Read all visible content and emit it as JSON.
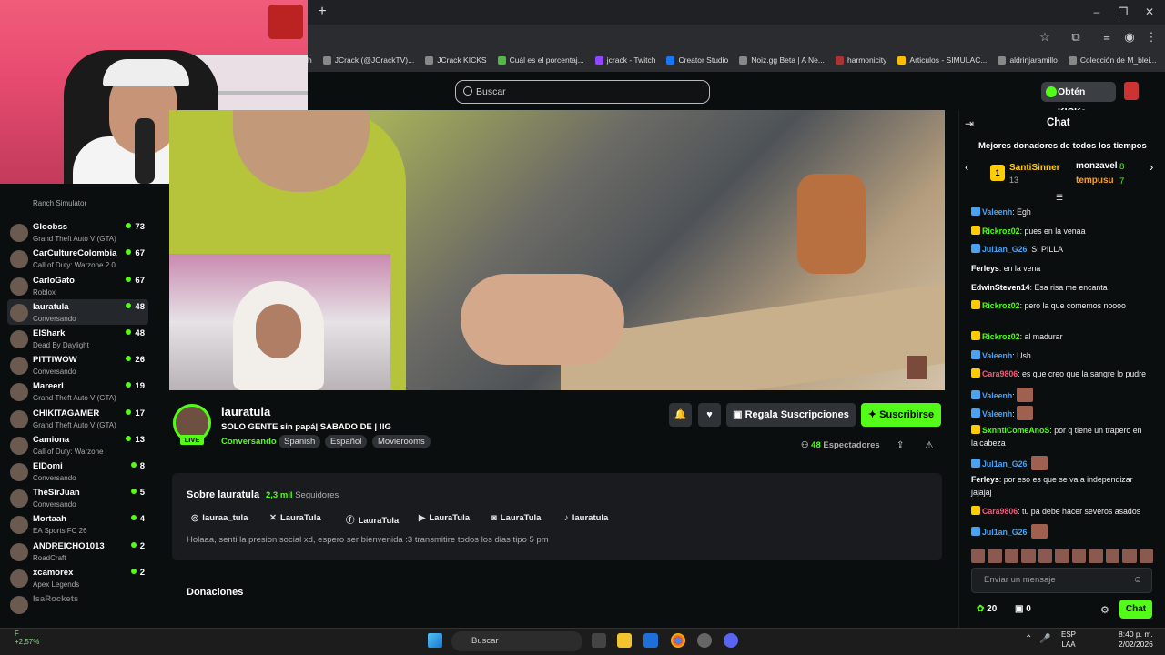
{
  "browser": {
    "bookmarks": [
      "h",
      "JCrack (@JCrackTV)...",
      "JCrack KICKS",
      "Cuál es el porcentaj...",
      "jcrack - Twitch",
      "Creator Studio",
      "Noiz.gg Beta | A Ne...",
      "harmonicity",
      "Articulos - SIMULAC...",
      "aldrinjaramillo",
      "Colección de M_blei..."
    ]
  },
  "header": {
    "search_placeholder": "Buscar",
    "kicks_button": "Obtén KICKs"
  },
  "sidebar": {
    "items": [
      {
        "name": "",
        "game": "Ranch Simulator",
        "viewers": ""
      },
      {
        "name": "Gloobss",
        "game": "Grand Theft Auto V (GTA)",
        "viewers": "73"
      },
      {
        "name": "CarCultureColombia",
        "game": "Call of Duty: Warzone 2.0",
        "viewers": "67"
      },
      {
        "name": "CarloGato",
        "game": "Roblox",
        "viewers": "67"
      },
      {
        "name": "lauratula",
        "game": "Conversando",
        "viewers": "48"
      },
      {
        "name": "ElShark",
        "game": "Dead By Daylight",
        "viewers": "48"
      },
      {
        "name": "PITTIWOW",
        "game": "Conversando",
        "viewers": "26"
      },
      {
        "name": "Mareerl",
        "game": "Grand Theft Auto V (GTA)",
        "viewers": "19"
      },
      {
        "name": "CHIKITAGAMER",
        "game": "Grand Theft Auto V (GTA)",
        "viewers": "17"
      },
      {
        "name": "Camiona",
        "game": "Call of Duty: Warzone",
        "viewers": "13"
      },
      {
        "name": "ElDomi",
        "game": "Conversando",
        "viewers": "8"
      },
      {
        "name": "TheSirJuan",
        "game": "Conversando",
        "viewers": "5"
      },
      {
        "name": "Mortaah",
        "game": "EA Sports FC 26",
        "viewers": "4"
      },
      {
        "name": "ANDREICHO1013",
        "game": "RoadCraft",
        "viewers": "2"
      },
      {
        "name": "xcamorex",
        "game": "Apex Legends",
        "viewers": "2"
      },
      {
        "name": "IsaRockets",
        "game": "",
        "viewers": ""
      }
    ]
  },
  "channel": {
    "name": "lauratula",
    "live": "LIVE",
    "title": "SOLO GENTE sin papá| SABADO DE | !IG",
    "category": "Conversando",
    "tags": [
      "Spanish",
      "Español",
      "Movierooms"
    ],
    "gift_button": "Regala Suscripciones",
    "subscribe_button": "Suscribirse",
    "viewers_count": "48",
    "viewers_label": "Espectadores"
  },
  "about": {
    "title": "Sobre lauratula",
    "followers_count": "2,3 mil",
    "followers_label": "Seguidores",
    "socials": [
      {
        "icon": "instagram-icon",
        "label": "lauraa_tula"
      },
      {
        "icon": "x-icon",
        "label": "LauraTula"
      },
      {
        "icon": "facebook-icon",
        "label": "LauraTula"
      },
      {
        "icon": "youtube-icon",
        "label": "LauraTula"
      },
      {
        "icon": "discord-icon",
        "label": "LauraTula"
      },
      {
        "icon": "tiktok-icon",
        "label": "lauratula"
      }
    ],
    "description": "Holaaa, senti la presion social xd, espero ser bienvenida :3 transmitire todos los dias tipo 5 pm",
    "donations_title": "Donaciones"
  },
  "chat": {
    "title": "Chat",
    "donors_title": "Mejores donadores de todos los tiempos",
    "donors": [
      {
        "rank": "1",
        "name": "SantiSinner",
        "amount": "13"
      },
      {
        "name": "monzavel",
        "amount": "8"
      },
      {
        "name": "tempusu",
        "amount": "7"
      }
    ],
    "messages": [
      {
        "user": "Valeenh",
        "color": "#4aa3f0",
        "text": "Egh"
      },
      {
        "user": "Rickroz02",
        "color": "#53fc18",
        "text": "pues en la venaa"
      },
      {
        "user": "Jul1an_G26",
        "color": "#4aa3f0",
        "text": "SI PILLA"
      },
      {
        "user": "Ferleys",
        "color": "#ffffff",
        "text": "en la vena"
      },
      {
        "user": "EdwinSteven14",
        "color": "#ffffff",
        "text": "Esa risa me encanta"
      },
      {
        "user": "Rickroz02",
        "color": "#53fc18",
        "text": "pero la que comemos noooo"
      },
      {
        "user": "Rickroz02",
        "color": "#53fc18",
        "text": "al madurar"
      },
      {
        "user": "Valeenh",
        "color": "#4aa3f0",
        "text": "Ush"
      },
      {
        "user": "Cara9806",
        "color": "#f05c7a",
        "text": "es que creo que la sangre lo pudre"
      },
      {
        "user": "Valeenh",
        "color": "#4aa3f0",
        "text": ""
      },
      {
        "user": "Valeenh",
        "color": "#4aa3f0",
        "text": ""
      },
      {
        "user": "SxnntiComeAnoS",
        "color": "#53fc18",
        "text": "por q tiene un trapero en la cabeza"
      },
      {
        "user": "Jul1an_G26",
        "color": "#4aa3f0",
        "text": ""
      },
      {
        "user": "Ferleys",
        "color": "#ffffff",
        "text": "por eso es que se va a independizar jajajaj"
      },
      {
        "user": "Cara9806",
        "color": "#f05c7a",
        "text": "tu pa debe hacer severos asados"
      },
      {
        "user": "Jul1an_G26",
        "color": "#4aa3f0",
        "text": ""
      }
    ],
    "input_placeholder": "Enviar un mensaje",
    "kicks": "20",
    "gifts": "0",
    "send_button": "Chat"
  },
  "taskbar": {
    "weather_temp": "F",
    "weather_change": "+2,57%",
    "search_placeholder": "Buscar",
    "lang_line1": "ESP",
    "lang_line2": "LAA",
    "time": "8:40 p. m.",
    "date": "2/02/2026"
  },
  "colors": {
    "accent": "#53fc18",
    "bg": "#0b0e0f"
  }
}
